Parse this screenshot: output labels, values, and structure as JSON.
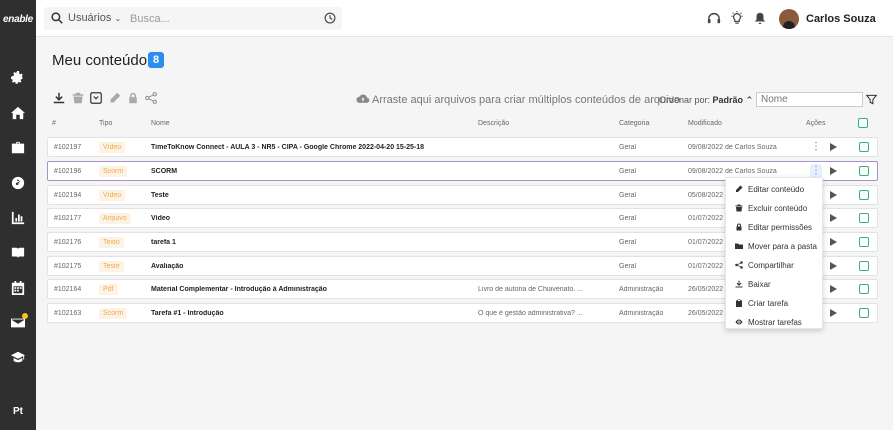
{
  "app": {
    "logo": "enable"
  },
  "sidebar": {
    "language": "Pt"
  },
  "topbar": {
    "search_scope": "Usuários",
    "search_placeholder": "Busca...",
    "user_name": "Carlos Souza"
  },
  "page": {
    "title": "Meu conteúdo",
    "count": "8"
  },
  "toolbar": {
    "dropzone": "Arraste aqui arquivos para criar múltiplos conteúdos de arquivo",
    "order_label": "Ordenar por:",
    "order_value": "Padrão",
    "name_placeholder": "Nome"
  },
  "table": {
    "headers": {
      "hash": "#",
      "type": "Tipo",
      "name": "Nome",
      "description": "Descrição",
      "category": "Categoria",
      "modified": "Modificado",
      "actions": "Ações"
    },
    "rows": [
      {
        "id": "#102197",
        "type": "Vídeo",
        "name": "TimeToKnow Connect - AULA 3 - NR5 - CIPA - Google Chrome 2022-04-20 15-25-18",
        "description": "",
        "category": "Geral",
        "modified": "09/08/2022 de Carlos Souza"
      },
      {
        "id": "#102196",
        "type": "Scorm",
        "name": "SCORM",
        "description": "",
        "category": "Geral",
        "modified": "09/08/2022 de Carlos Souza"
      },
      {
        "id": "#102194",
        "type": "Vídeo",
        "name": "Teste",
        "description": "",
        "category": "Geral",
        "modified": "05/08/2022"
      },
      {
        "id": "#102177",
        "type": "Arquivo",
        "name": "Vídeo",
        "description": "",
        "category": "Geral",
        "modified": "01/07/2022"
      },
      {
        "id": "#102176",
        "type": "Texto",
        "name": "tarefa 1",
        "description": "",
        "category": "Geral",
        "modified": "01/07/2022"
      },
      {
        "id": "#102175",
        "type": "Teste",
        "name": "Avaliação",
        "description": "",
        "category": "Geral",
        "modified": "01/07/2022"
      },
      {
        "id": "#102164",
        "type": "Pdf",
        "name": "Material Complementar - Introdução à Administração",
        "description": "Livro de autoria de Chiavenato. ...",
        "category": "Administração",
        "modified": "26/05/2022"
      },
      {
        "id": "#102163",
        "type": "Scorm",
        "name": "Tarefa #1 - Introdução",
        "description": "O que é gestão administrativa? ...",
        "category": "Administração",
        "modified": "26/05/2022"
      }
    ]
  },
  "context_menu": {
    "items": [
      {
        "label": "Editar conteúdo",
        "icon": "pencil-icon"
      },
      {
        "label": "Excluir conteúdo",
        "icon": "trash-icon"
      },
      {
        "label": "Editar permissões",
        "icon": "lock-icon"
      },
      {
        "label": "Mover para a pasta",
        "icon": "folder-icon"
      },
      {
        "label": "Compartilhar",
        "icon": "share-icon"
      },
      {
        "label": "Baixar",
        "icon": "download-icon"
      },
      {
        "label": "Criar tarefa",
        "icon": "clipboard-icon"
      },
      {
        "label": "Mostrar tarefas",
        "icon": "eye-icon"
      }
    ]
  },
  "colors": {
    "sidebar": "#2f2f2f",
    "accent": "#2d8cf0",
    "badge_text": "#f0a94d",
    "check": "#2bb673"
  }
}
